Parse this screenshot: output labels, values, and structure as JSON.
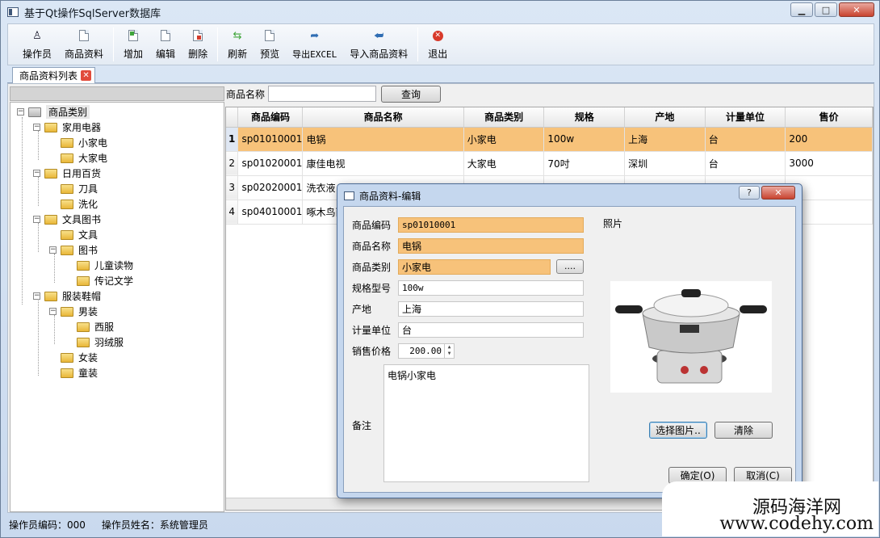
{
  "window": {
    "title": "基于Qt操作SqlServer数据库",
    "caption_buttons": [
      "minimize-icon",
      "maximize-icon",
      "close-icon"
    ]
  },
  "toolbar": {
    "items": [
      {
        "label": "操作员",
        "icon": "user-icon"
      },
      {
        "label": "商品资料",
        "icon": "document-icon"
      },
      {
        "label": "增加",
        "icon": "add-doc-icon"
      },
      {
        "label": "编辑",
        "icon": "edit-doc-icon"
      },
      {
        "label": "删除",
        "icon": "delete-doc-icon"
      },
      {
        "label": "刷新",
        "icon": "refresh-icon"
      },
      {
        "label": "预览",
        "icon": "preview-icon"
      },
      {
        "label": "导出EXCEL",
        "icon": "export-icon"
      },
      {
        "label": "导入商品资料",
        "icon": "import-icon"
      },
      {
        "label": "退出",
        "icon": "exit-icon"
      }
    ]
  },
  "tab": {
    "label": "商品资料列表"
  },
  "tree": {
    "root": "商品类别",
    "nodes": [
      "家用电器",
      "小家电",
      "大家电",
      "日用百货",
      "刀具",
      "洗化",
      "文具图书",
      "文具",
      "图书",
      "儿童读物",
      "传记文学",
      "服装鞋帽",
      "男装",
      "西服",
      "羽绒服",
      "女装",
      "童装"
    ]
  },
  "search": {
    "label": "商品名称",
    "value": "",
    "button": "查询"
  },
  "table": {
    "columns": [
      "商品编码",
      "商品名称",
      "商品类别",
      "规格",
      "产地",
      "计量单位",
      "售价"
    ],
    "rows": [
      {
        "num": "1",
        "cells": [
          "sp01010001",
          "电锅",
          "小家电",
          "100w",
          "上海",
          "台",
          "200"
        ]
      },
      {
        "num": "2",
        "cells": [
          "sp01020001",
          "康佳电视",
          "大家电",
          "70吋",
          "深圳",
          "台",
          "3000"
        ]
      },
      {
        "num": "3",
        "cells": [
          "sp02020001",
          "洗衣液",
          "",
          "",
          "",
          "",
          ""
        ]
      },
      {
        "num": "4",
        "cells": [
          "sp04010001",
          "啄木鸟西",
          "",
          "",
          "",
          "",
          "00"
        ]
      }
    ]
  },
  "dialog": {
    "title": "商品资料-编辑",
    "fields": {
      "code_label": "商品编码",
      "code": "sp01010001",
      "name_label": "商品名称",
      "name": "电锅",
      "category_label": "商品类别",
      "category": "小家电",
      "browse": "....",
      "spec_label": "规格型号",
      "spec": "100w",
      "origin_label": "产地",
      "origin": "上海",
      "unit_label": "计量单位",
      "unit": "台",
      "price_label": "销售价格",
      "price": "200.00",
      "remark_label": "备注",
      "remark": "电锅小家电"
    },
    "photo": {
      "label": "照片",
      "select": "选择图片..",
      "clear": "清除"
    },
    "ok": "确定(O)",
    "cancel": "取消(C)"
  },
  "status": {
    "operator_code": "操作员编码：000",
    "operator_name": "操作员姓名：系统管理员"
  },
  "watermark": {
    "line1": "源码海洋网",
    "line2": "www.codehy.com"
  },
  "colors": {
    "selection": "#f7c27a",
    "window_bg": "#dfe7f1"
  }
}
